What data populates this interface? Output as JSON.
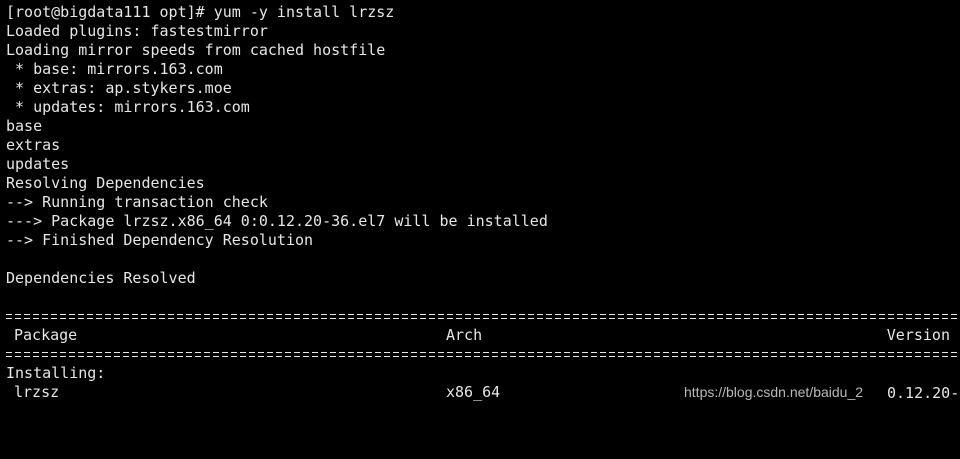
{
  "terminal": {
    "lines": [
      "[root@bigdata111 opt]# yum -y install lrzsz",
      "Loaded plugins: fastestmirror",
      "Loading mirror speeds from cached hostfile",
      " * base: mirrors.163.com",
      " * extras: ap.stykers.moe",
      " * updates: mirrors.163.com",
      "base",
      "extras",
      "updates",
      "Resolving Dependencies",
      "--> Running transaction check",
      "---> Package lrzsz.x86_64 0:0.12.20-36.el7 will be installed",
      "--> Finished Dependency Resolution",
      "",
      "Dependencies Resolved",
      ""
    ],
    "table": {
      "headers": {
        "package": "Package",
        "arch": "Arch",
        "version": "Version"
      },
      "section_label": "Installing:",
      "row": {
        "package": "lrzsz",
        "arch": "x86_64",
        "version": "0.12.20-"
      }
    }
  },
  "watermark": {
    "text": "https://blog.csdn.net/baidu_2"
  },
  "colors": {
    "background": "#000000",
    "text": "#e6e6e6"
  }
}
